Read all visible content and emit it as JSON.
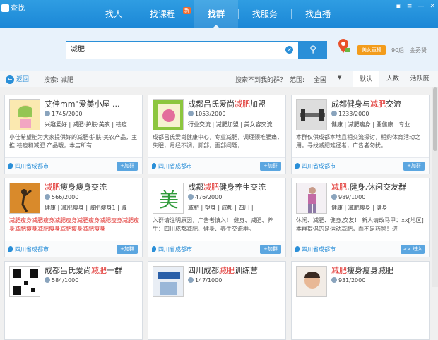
{
  "app": {
    "title": "查找"
  },
  "nav": {
    "items": [
      "找人",
      "找课程",
      "找群",
      "找服务",
      "找直播"
    ],
    "new_badge": "新",
    "active_index": 2
  },
  "search": {
    "value": "减肥",
    "clear_icon": "clear-icon",
    "button_icon": "search-icon"
  },
  "live": {
    "button": "美女直播",
    "tags": [
      "90后",
      "金秀贤"
    ]
  },
  "filter": {
    "back": "返回",
    "search_label": "搜索: 减肥",
    "hint": "搜索不到我的群？",
    "range_label": "范围:",
    "range_value": "全国",
    "sort_tabs": [
      "默认",
      "人数",
      "活跃度"
    ]
  },
  "cards": [
    {
      "title_pre": "艾佳mm\"爱美小屋 ...",
      "title_hl": "",
      "title_post": "",
      "members": "1745/2000",
      "tags": "兴趣爱好 | 减肥·护肤·美农 | 祛痘",
      "desc": "小佳希望能为大家提供好的减肥·护肤·美农产品，主推 祛痘和减肥 产品哦，本店所有",
      "city": "四川省成都市",
      "join": "+加群"
    },
    {
      "title_pre": "成都吕氏爱尚",
      "title_hl": "减肥",
      "title_post": "加盟",
      "members": "1053/2000",
      "tags": "行业交流 | 减肥加盟 | 美女容交流",
      "desc": "成都吕氏爱尚健康中心，专业减肥，调理颈椎腰痛，失眠，月经不调，脚部，面部问题，",
      "city": "四川省成都市",
      "join": "+加群"
    },
    {
      "title_pre": "成都健身与",
      "title_hl": "减肥",
      "title_post": "交流",
      "members": "1233/2000",
      "tags": "健康 | 减肥瘦身 | 亚健康 | 专业",
      "desc": "本群仅供成都本地且相交流探讨，相约体育活动之用。寻找减肥难径者，广告者勿扰。",
      "city": "四川省成都市",
      "join": "+加群"
    },
    {
      "title_pre": "",
      "title_hl": "减肥",
      "title_post": "瘦身瘦身交流",
      "members": "566/2000",
      "tags": "健康 | 减肥瘦身 | 减肥瘦身1 | 减",
      "desc": "减肥瘦身减肥瘦身减肥瘦身减肥瘦身减肥瘦身减肥瘦身减肥瘦身减肥瘦身减肥瘦身减肥瘦身",
      "city": "四川省成都市",
      "join": "+加群"
    },
    {
      "title_pre": "成都",
      "title_hl": "减肥",
      "title_post": "健身养生交流",
      "members": "476/2000",
      "tags": "减肥 | 塑身 | 成都 | 四川 |",
      "desc": "入群请注明原因，广告者慎入！ 健身、减肥、养生：四川成都减肥、健身、养生交流群。",
      "city": "四川省成都市",
      "join": "+加群"
    },
    {
      "title_pre": "",
      "title_hl": "减肥",
      "title_post": ",健身,休闲交友群",
      "members": "989/1000",
      "tags": "健康 | 减肥瘦身 | 健身",
      "desc": "休闲、减肥、健身,交友！ 新人请改马甲：xx[地区] 本群提倡的是运动减肥，而不是药物！进",
      "city": "四川省成都市",
      "join": ">> 进入"
    },
    {
      "title_pre": "成都吕氏爱尚",
      "title_hl": "减肥",
      "title_post": "一群",
      "members": "584/1000",
      "tags": "",
      "desc": "",
      "city": "",
      "join": ""
    },
    {
      "title_pre": "四川成都",
      "title_hl": "减肥",
      "title_post": "训练营",
      "members": "147/1000",
      "tags": "",
      "desc": "",
      "city": "",
      "join": ""
    },
    {
      "title_pre": "",
      "title_hl": "减肥",
      "title_post": "瘦身瘦身减肥",
      "members": "931/2000",
      "tags": "",
      "desc": "",
      "city": "",
      "join": ""
    }
  ],
  "colors": {
    "primary": "#2a8fd8",
    "highlight": "#e0302d",
    "live": "#f39c1b"
  }
}
